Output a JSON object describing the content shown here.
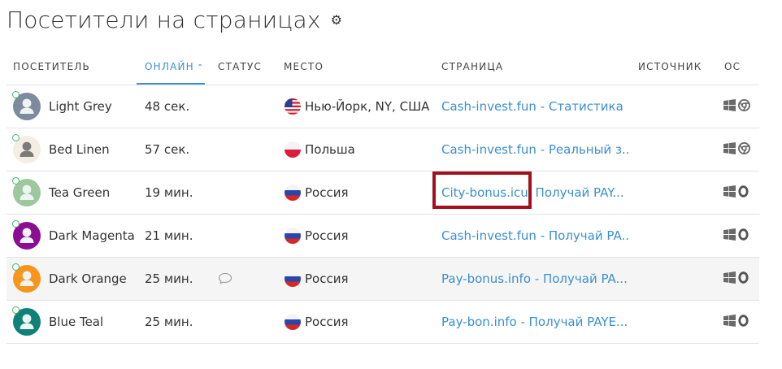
{
  "page": {
    "title": "Посетители на страницах",
    "settings_icon": "gear-icon"
  },
  "columns": {
    "visitor": "ПОСЕТИТЕЛЬ",
    "online": "ОНЛАЙН",
    "status": "СТАТУС",
    "place": "МЕСТО",
    "page": "СТРАНИЦА",
    "source": "ИСТОЧНИК",
    "os": "ОС",
    "sort_column": "online",
    "sort_direction": "asc"
  },
  "colors": {
    "accent": "#3a8fd0",
    "online_dot": "#43b86b",
    "highlight_box": "#a3101d"
  },
  "rows": [
    {
      "name": "Light Grey",
      "avatar_color": "#7e8b9e",
      "online": "48 сек.",
      "place": "Нью-Йорк, NY, США",
      "flag": "us-flag",
      "page_primary": "Cash-invest.fun - Статистика",
      "page_secondary": "",
      "status_icon": "",
      "browser": "chrome-icon"
    },
    {
      "name": "Bed Linen",
      "avatar_color": "#f5ece2",
      "online": "57 сек.",
      "place": "Польша",
      "flag": "pl-flag",
      "page_primary": "Cash-invest.fun - Реальный з...",
      "page_secondary": "",
      "status_icon": "",
      "browser": "chrome-icon"
    },
    {
      "name": "Tea Green",
      "avatar_color": "#9cc89b",
      "online": "19 мин.",
      "place": "Россия",
      "flag": "ru-flag",
      "page_primary": "City-bonus.icu",
      "page_secondary": "Получай PAY...",
      "status_icon": "",
      "browser": "opera-icon"
    },
    {
      "name": "Dark Magenta",
      "avatar_color": "#8d0c94",
      "online": "21 мин.",
      "place": "Россия",
      "flag": "ru-flag",
      "page_primary": "Cash-invest.fun - Получай PA...",
      "page_secondary": "",
      "status_icon": "",
      "browser": "opera-icon"
    },
    {
      "name": "Dark Orange",
      "avatar_color": "#f7951d",
      "online": "25 мин.",
      "place": "Россия",
      "flag": "ru-flag",
      "page_primary": "Pay-bonus.info - Получай PA...",
      "page_secondary": "",
      "status_icon": "chat-bubble-icon",
      "browser": "opera-icon"
    },
    {
      "name": "Blue Teal",
      "avatar_color": "#0f8178",
      "online": "25 мин.",
      "place": "Россия",
      "flag": "ru-flag",
      "page_primary": "Pay-bon.info - Получай PAYE...",
      "page_secondary": "",
      "status_icon": "",
      "browser": "opera-icon"
    }
  ]
}
